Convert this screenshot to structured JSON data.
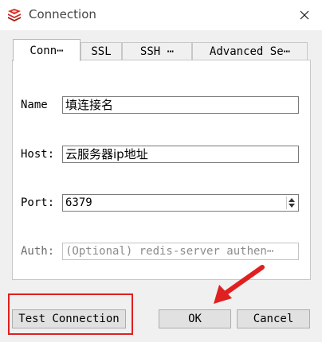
{
  "window": {
    "title": "Connection",
    "icon": "redis-icon"
  },
  "tabs": [
    {
      "label": "Conn⋯",
      "active": true
    },
    {
      "label": "SSL",
      "active": false
    },
    {
      "label": "SSH ⋯",
      "active": false
    },
    {
      "label": "Advanced Se⋯",
      "active": false
    }
  ],
  "form": {
    "name_label": "Name",
    "name_value": "填连接名",
    "host_label": "Host:",
    "host_value": "云服务器ip地址",
    "port_label": "Port:",
    "port_value": "6379",
    "auth_label": "Auth:",
    "auth_placeholder": "(Optional) redis-server authen⋯"
  },
  "buttons": {
    "test_connection": "Test Connection",
    "ok": "OK",
    "cancel": "Cancel"
  },
  "colors": {
    "annotation": "#e02020",
    "accent": "#d9281d"
  }
}
